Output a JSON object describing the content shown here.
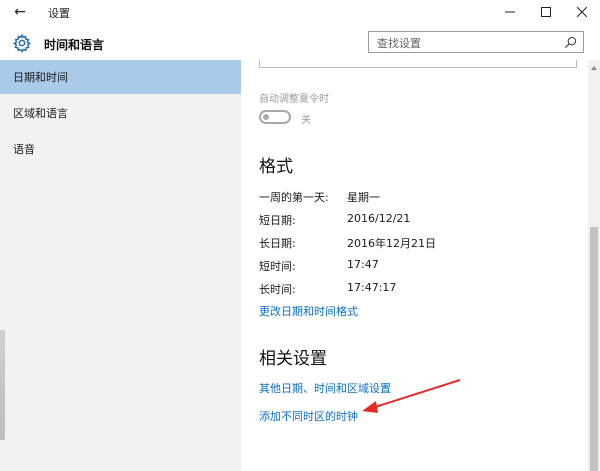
{
  "window": {
    "title": "设置",
    "controls": {
      "back": "←",
      "minimize": "—",
      "maximize": "☐",
      "close": "✕"
    }
  },
  "header": {
    "app_title": "时间和语言",
    "icon": "gear-icon",
    "search": {
      "placeholder": "查找设置",
      "icon": "search-icon"
    }
  },
  "sidebar": {
    "items": [
      {
        "label": "日期和时间",
        "active": true
      },
      {
        "label": "区域和语言",
        "active": false
      },
      {
        "label": "语音",
        "active": false
      }
    ]
  },
  "content": {
    "dst": {
      "label": "自动调整夏令时",
      "toggle_state": "关",
      "on": false
    },
    "format": {
      "title": "格式",
      "rows": [
        {
          "label": "一周的第一天:",
          "value": "星期一"
        },
        {
          "label": "短日期:",
          "value": "2016/12/21"
        },
        {
          "label": "长日期:",
          "value": "2016年12月21日"
        },
        {
          "label": "短时间:",
          "value": "17:47"
        },
        {
          "label": "长时间:",
          "value": "17:47:17"
        }
      ],
      "link": "更改日期和时间格式"
    },
    "related": {
      "title": "相关设置",
      "links": [
        "其他日期、时间和区域设置",
        "添加不同时区的时钟"
      ]
    }
  },
  "colors": {
    "accent_link": "#0c6fc7",
    "sidebar_bg": "#f2f2f2",
    "sidebar_active": "#a9cae8",
    "annotation_arrow": "#e52a24"
  }
}
